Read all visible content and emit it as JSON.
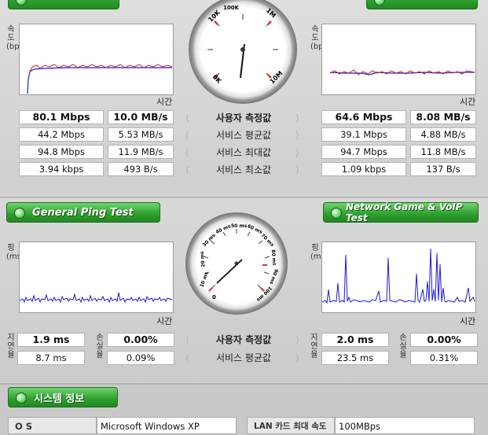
{
  "speed": {
    "ylabel": "속도(bps)",
    "xlabel": "시간",
    "gauge_ticks": [
      "0K",
      "10K",
      "100K",
      "1M",
      "10M"
    ],
    "left": {
      "user": [
        "80.1 Mbps",
        "10.0 MB/s"
      ],
      "avg": [
        "44.2 Mbps",
        "5.53 MB/s"
      ],
      "max": [
        "94.8 Mbps",
        "11.9 MB/s"
      ],
      "min": [
        "3.94 kbps",
        "493 B/s"
      ]
    },
    "right": {
      "user": [
        "64.6 Mbps",
        "8.08 MB/s"
      ],
      "avg": [
        "39.1 Mbps",
        "4.88 MB/s"
      ],
      "max": [
        "94.7 Mbps",
        "11.8 MB/s"
      ],
      "min": [
        "1.09 kbps",
        "137 B/s"
      ]
    },
    "labels": {
      "user": "사용자 측정값",
      "avg": "서비스 평균값",
      "max": "서비스 최대값",
      "min": "서비스 최소값"
    }
  },
  "ping": {
    "left_button": "General Ping Test",
    "right_button": "Network Game & VoIP Test",
    "ylabel": "핑(ms)",
    "xlabel": "시간",
    "delay_label": "지연율",
    "loss_label": "손실율",
    "gauge_ticks": [
      "0",
      "10 ms",
      "20 ms",
      "30 ms",
      "40 ms",
      "50 ms",
      "60 ms",
      "70 ms",
      "80 ms",
      "90 ms",
      "100 ms"
    ],
    "left": {
      "user_delay": "1.9 ms",
      "user_loss": "0.00%",
      "avg_delay": "8.7 ms",
      "avg_loss": "0.09%"
    },
    "right": {
      "user_delay": "2.0 ms",
      "user_loss": "0.00%",
      "avg_delay": "23.5 ms",
      "avg_loss": "0.31%"
    },
    "labels": {
      "user": "사용자 측정값",
      "avg": "서비스 평균값"
    }
  },
  "system": {
    "button": "시스템 정보",
    "os_label": "O S",
    "os_value": "Microsoft Windows XP",
    "lan_label": "LAN 카드 최대 속도",
    "lan_value": "100MBps"
  },
  "colors": {
    "green": "#2e9e2e",
    "series_blue": "#1a1ad6",
    "series_red": "#d62020"
  }
}
